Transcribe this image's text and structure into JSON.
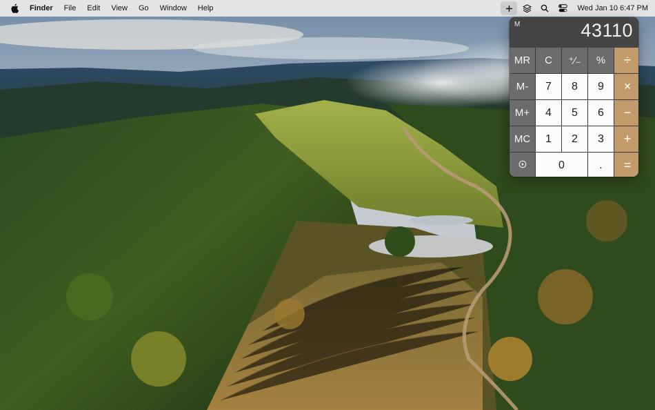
{
  "menubar": {
    "apple_icon": "apple-logo",
    "app_name": "Finder",
    "menus": [
      "File",
      "Edit",
      "View",
      "Go",
      "Window",
      "Help"
    ],
    "status_icons": [
      "plus-icon",
      "layers-icon",
      "search-icon",
      "control-center-icon"
    ],
    "clock": "Wed Jan 10  6:47 PM"
  },
  "calculator": {
    "memory_indicator": "M",
    "display": "43110",
    "rows": [
      [
        {
          "label": "MR",
          "kind": "fn",
          "name": "memory-recall-button"
        },
        {
          "label": "C",
          "kind": "fn",
          "name": "clear-button"
        },
        {
          "label": "⁺∕₋",
          "kind": "fn",
          "name": "sign-toggle-button"
        },
        {
          "label": "%",
          "kind": "fn",
          "name": "percent-button"
        },
        {
          "label": "÷",
          "kind": "op",
          "name": "divide-button"
        }
      ],
      [
        {
          "label": "M-",
          "kind": "fn",
          "name": "memory-minus-button"
        },
        {
          "label": "7",
          "kind": "num",
          "name": "digit-7-button"
        },
        {
          "label": "8",
          "kind": "num",
          "name": "digit-8-button"
        },
        {
          "label": "9",
          "kind": "num",
          "name": "digit-9-button"
        },
        {
          "label": "×",
          "kind": "op",
          "name": "multiply-button"
        }
      ],
      [
        {
          "label": "M+",
          "kind": "fn",
          "name": "memory-plus-button"
        },
        {
          "label": "4",
          "kind": "num",
          "name": "digit-4-button"
        },
        {
          "label": "5",
          "kind": "num",
          "name": "digit-5-button"
        },
        {
          "label": "6",
          "kind": "num",
          "name": "digit-6-button"
        },
        {
          "label": "−",
          "kind": "op",
          "name": "subtract-button"
        }
      ],
      [
        {
          "label": "MC",
          "kind": "fn",
          "name": "memory-clear-button"
        },
        {
          "label": "1",
          "kind": "num",
          "name": "digit-1-button"
        },
        {
          "label": "2",
          "kind": "num",
          "name": "digit-2-button"
        },
        {
          "label": "3",
          "kind": "num",
          "name": "digit-3-button"
        },
        {
          "label": "+",
          "kind": "op",
          "name": "add-button"
        }
      ],
      [
        {
          "label": "",
          "kind": "fn",
          "name": "calculator-menu-button",
          "icon": "calculator-icon"
        },
        {
          "label": "0",
          "kind": "num",
          "name": "digit-0-button",
          "wide": true
        },
        {
          "label": ".",
          "kind": "num",
          "name": "decimal-button"
        },
        {
          "label": "=",
          "kind": "op",
          "name": "equals-button"
        }
      ]
    ]
  },
  "colors": {
    "operator_key": "#c29a6c",
    "function_key": "#6c6c6c",
    "number_key": "#fbfbfb",
    "display_bg": "#454545"
  }
}
